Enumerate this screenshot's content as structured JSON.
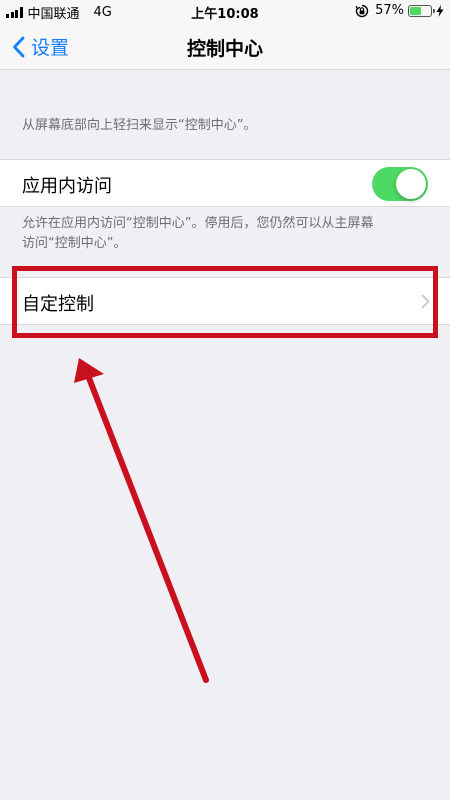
{
  "status_bar": {
    "carrier": "中国联通",
    "network": "4G",
    "time": "上午10:08",
    "battery_percent": "57%",
    "battery_level": 0.57
  },
  "nav": {
    "back_label": "设置",
    "title": "控制中心"
  },
  "footnotes": {
    "top": "从屏幕底部向上轻扫来显示“控制中心”。",
    "access_line1": "允许在应用内访问“控制中心”。停用后，您仍然可以从主屏幕",
    "access_line2": "访问“控制中心”。"
  },
  "cells": {
    "in_app_access": {
      "label": "应用内访问",
      "enabled": true
    },
    "customize": {
      "label": "自定控制"
    }
  },
  "colors": {
    "accent": "#147efb",
    "toggle_on": "#4cd964",
    "annotation": "#c8101e"
  },
  "icons": {
    "back": "chevron-left-icon",
    "disclosure": "chevron-right-icon",
    "orientation_lock": "orientation-lock-icon",
    "charging": "bolt-icon"
  }
}
